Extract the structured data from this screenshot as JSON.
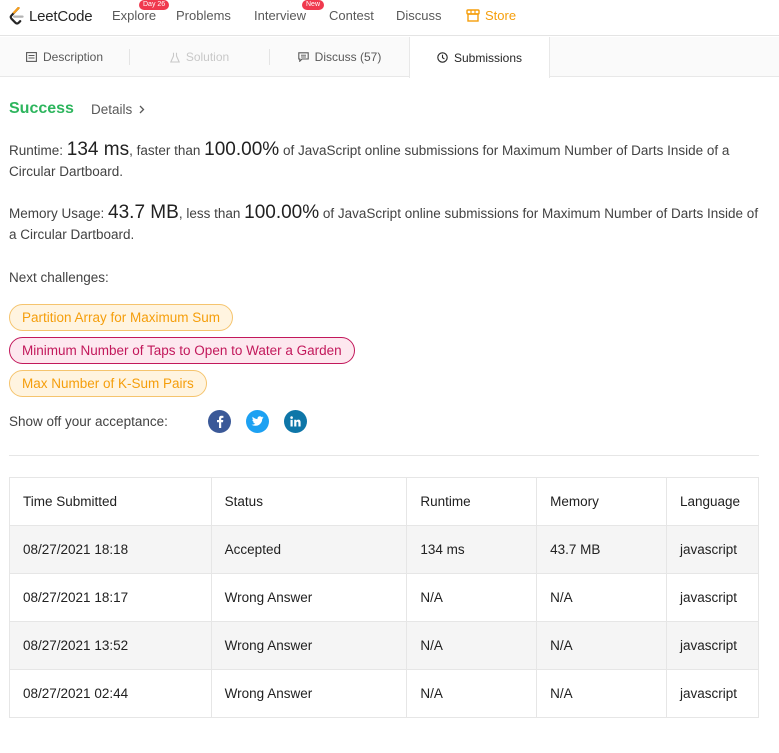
{
  "nav": {
    "logo_text": "LeetCode",
    "items": [
      {
        "label": "Explore",
        "badge": "Day 26"
      },
      {
        "label": "Problems",
        "badge": ""
      },
      {
        "label": "Interview",
        "badge": "New"
      },
      {
        "label": "Contest",
        "badge": ""
      },
      {
        "label": "Discuss",
        "badge": ""
      }
    ],
    "store_label": "Store"
  },
  "tabs": [
    {
      "label": "Description",
      "icon": "description-icon",
      "state": "normal"
    },
    {
      "label": "Solution",
      "icon": "flask-icon",
      "state": "disabled"
    },
    {
      "label": "Discuss (57)",
      "icon": "comment-icon",
      "state": "normal"
    },
    {
      "label": "Submissions",
      "icon": "clock-icon",
      "state": "active"
    }
  ],
  "result": {
    "status": "Success",
    "details_label": "Details",
    "runtime": {
      "label": "Runtime:",
      "value": "134 ms",
      "mid": ", faster than",
      "percent": "100.00%",
      "suffix": "of JavaScript online submissions for Maximum Number of Darts Inside of a Circular Dartboard."
    },
    "memory": {
      "label": "Memory Usage:",
      "value": "43.7 MB",
      "mid": ", less than",
      "percent": "100.00%",
      "suffix": "of JavaScript online submissions for Maximum Number of Darts Inside of a Circular Dartboard."
    }
  },
  "next_challenges": {
    "label": "Next challenges:",
    "items": [
      {
        "title": "Partition Array for Maximum Sum",
        "difficulty": "medium"
      },
      {
        "title": "Minimum Number of Taps to Open to Water a Garden",
        "difficulty": "hard"
      },
      {
        "title": "Max Number of K-Sum Pairs",
        "difficulty": "medium"
      }
    ]
  },
  "share": {
    "label": "Show off your acceptance:",
    "icons": [
      "facebook-icon",
      "twitter-icon",
      "linkedin-icon"
    ]
  },
  "submissions": {
    "headers": [
      "Time Submitted",
      "Status",
      "Runtime",
      "Memory",
      "Language"
    ],
    "rows": [
      {
        "time": "08/27/2021 18:18",
        "status": "Accepted",
        "runtime": "134 ms",
        "memory": "43.7 MB",
        "language": "javascript"
      },
      {
        "time": "08/27/2021 18:17",
        "status": "Wrong Answer",
        "runtime": "N/A",
        "memory": "N/A",
        "language": "javascript"
      },
      {
        "time": "08/27/2021 13:52",
        "status": "Wrong Answer",
        "runtime": "N/A",
        "memory": "N/A",
        "language": "javascript"
      },
      {
        "time": "08/27/2021 02:44",
        "status": "Wrong Answer",
        "runtime": "N/A",
        "memory": "N/A",
        "language": "javascript"
      }
    ]
  },
  "colors": {
    "accent_green": "#2db55d",
    "store_orange": "#f59e0b",
    "wrong_red": "#d32f2f",
    "hard_pink": "#c2185b",
    "badge_red": "#f0394e"
  }
}
